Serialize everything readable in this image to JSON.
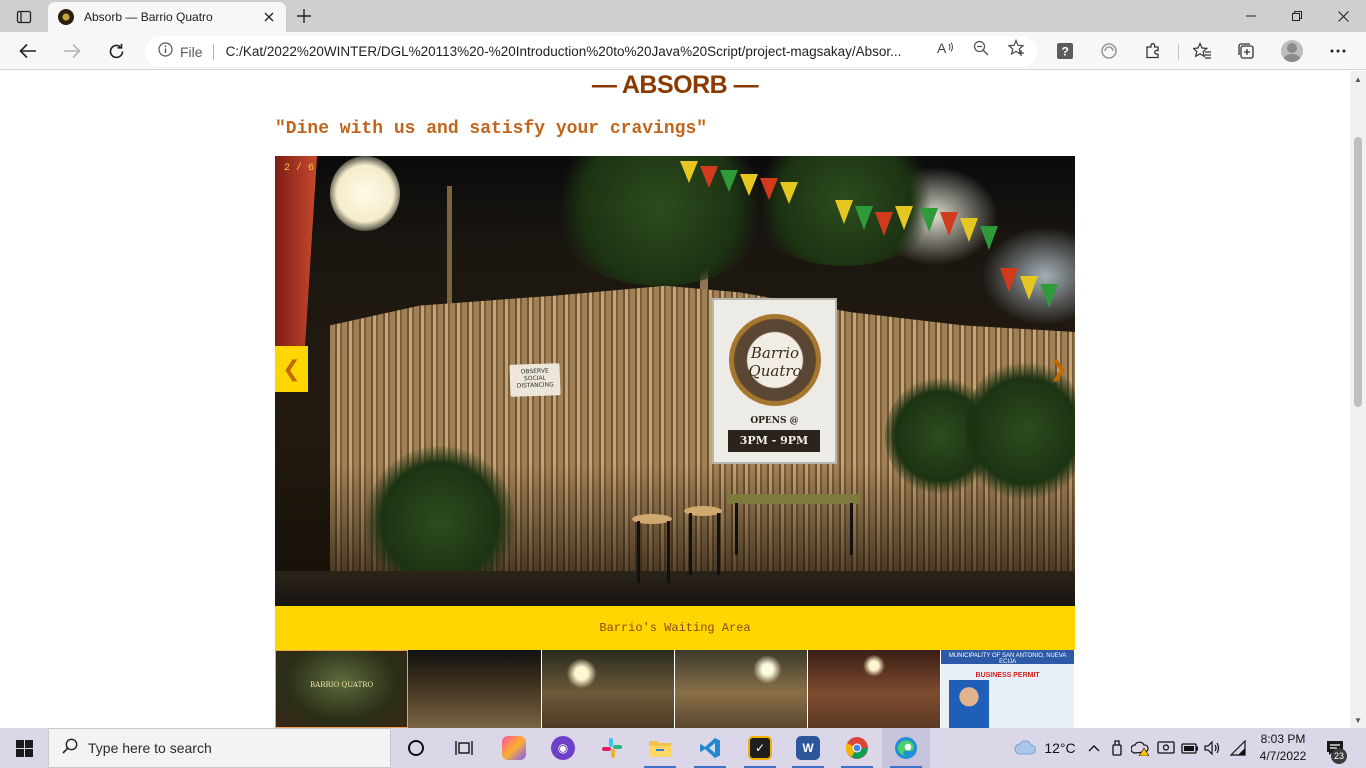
{
  "browser": {
    "tab_title": "Absorb — Barrio Quatro",
    "address_prefix": "File",
    "url": "C:/Kat/2022%20WINTER/DGL%20113%20-%20Introduction%20to%20Java%20Script/project-magsakay/Absor..."
  },
  "page": {
    "title": "— ABSORB —",
    "tagline": "\"Dine with us and satisfy your cravings\"",
    "slideshow": {
      "counter": "2 / 6",
      "prev_label": "❮",
      "next_label": "❯",
      "caption": "Barrio's Waiting Area",
      "banner_logo": "Barrio Quatro",
      "banner_opens": "OPENS @",
      "banner_hours": "3PM - 9PM",
      "sign_text": "OBSERVE SOCIAL DISTANCING"
    },
    "thumbnails": [
      {
        "label": "BARRIO QUATRO"
      },
      {
        "label": ""
      },
      {
        "label": ""
      },
      {
        "label": ""
      },
      {
        "label": ""
      },
      {
        "label": "",
        "permit_title": "MUNICIPALITY OF SAN ANTONIO, NUEVA ECIJA",
        "permit_sub": "BUSINESS PERMIT"
      }
    ]
  },
  "taskbar": {
    "search_placeholder": "Type here to search",
    "weather": "12°C",
    "time": "8:03 PM",
    "date": "4/7/2022",
    "notifications": "23"
  },
  "colors": {
    "title": "#8a3a00",
    "tagline": "#c0651c",
    "accent_yellow": "#ffd600",
    "caption_text": "#8a4a15"
  }
}
